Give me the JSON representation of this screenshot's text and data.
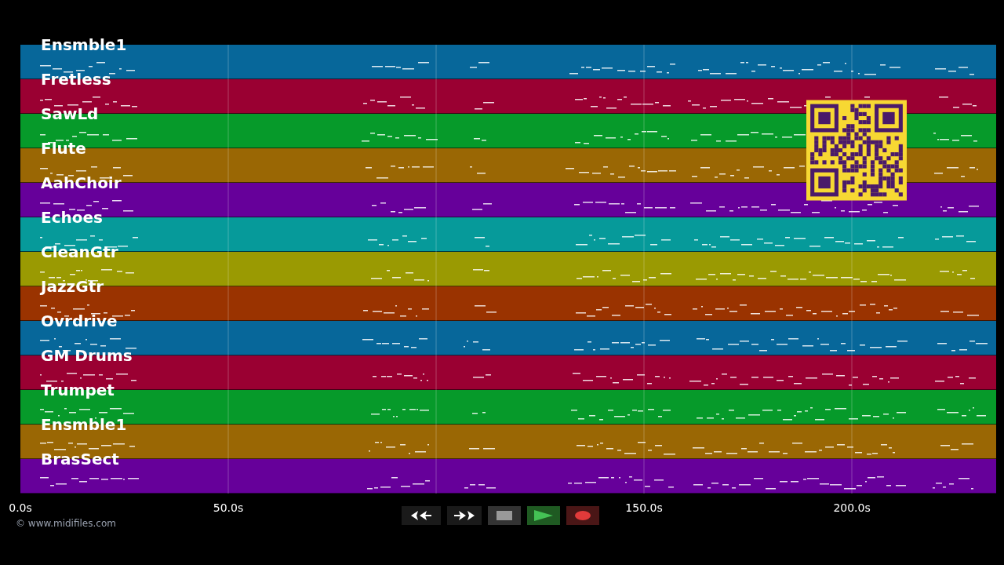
{
  "tracks": [
    {
      "name": "Ensmble1",
      "color": "#07679a"
    },
    {
      "name": "Fretless",
      "color": "#9a0032"
    },
    {
      "name": "SawLd",
      "color": "#069a2a"
    },
    {
      "name": "Flute",
      "color": "#9a6704"
    },
    {
      "name": "AahChoir",
      "color": "#66009a"
    },
    {
      "name": "Echoes",
      "color": "#069a9a"
    },
    {
      "name": "CleanGtr",
      "color": "#9a9a02"
    },
    {
      "name": "JazzGtr",
      "color": "#9a3300"
    },
    {
      "name": "Ovrdrive",
      "color": "#07679a"
    },
    {
      "name": "GM Drums",
      "color": "#9a0032"
    },
    {
      "name": "Trumpet",
      "color": "#069a2a"
    },
    {
      "name": "Ensmble1",
      "color": "#9a6704"
    },
    {
      "name": "BrasSect",
      "color": "#66009a"
    }
  ],
  "time_axis": {
    "ticks": [
      "0.0s",
      "50.0s",
      "150.0s",
      "200.0s"
    ]
  },
  "transport": [
    {
      "kind": "rewind"
    },
    {
      "kind": "forward"
    },
    {
      "kind": "stop"
    },
    {
      "kind": "play"
    },
    {
      "kind": "record"
    }
  ],
  "credit": "© www.midifiles.com"
}
